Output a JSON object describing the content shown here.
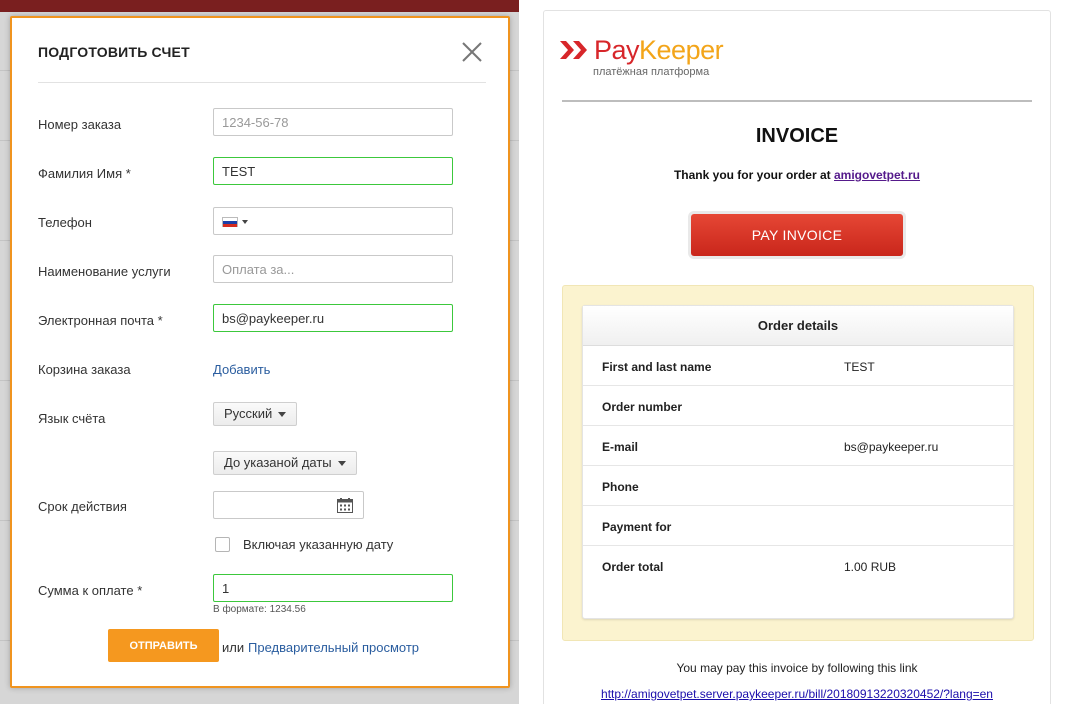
{
  "modal": {
    "title": "ПОДГОТОВИТЬ СЧЕТ",
    "fields": {
      "order_number": {
        "label": "Номер заказа",
        "value": "",
        "placeholder": "1234-56-78"
      },
      "full_name": {
        "label": "Фамилия Имя *",
        "value": "TEST",
        "placeholder": ""
      },
      "phone": {
        "label": "Телефон",
        "value": "",
        "flag": "ru-flag"
      },
      "service_name": {
        "label": "Наименование услуги",
        "value": "",
        "placeholder": "Оплата за..."
      },
      "email": {
        "label": "Электронная почта *",
        "value": "bs@paykeeper.ru",
        "placeholder": ""
      },
      "cart": {
        "label": "Корзина заказа",
        "link": "Добавить"
      },
      "language": {
        "label": "Язык счёта",
        "selected": "Русский"
      },
      "validity": {
        "label": "Срок действия",
        "mode": "До указаной даты",
        "date_value": "",
        "include_date_label": "Включая указанную дату",
        "include_date_checked": false
      },
      "amount": {
        "label": "Сумма к оплате *",
        "value": "1",
        "hint": "В формате: 1234.56"
      }
    },
    "submit_label": "ОТПРАВИТЬ",
    "or_text": "или",
    "preview_link": "Предварительный просмотр"
  },
  "invoice": {
    "logo": {
      "pay": "Pay",
      "keeper": "Keeper",
      "subtitle": "платёжная платформа"
    },
    "title": "INVOICE",
    "thanks_prefix": "Thank you for your order at",
    "shop_link": "amigovetpet.ru",
    "pay_button": "PAY INVOICE",
    "details_header": "Order details",
    "rows": [
      {
        "key": "First and last name",
        "value": "TEST"
      },
      {
        "key": "Order number",
        "value": ""
      },
      {
        "key": "E-mail",
        "value": "bs@paykeeper.ru"
      },
      {
        "key": "Phone",
        "value": ""
      },
      {
        "key": "Payment for",
        "value": ""
      },
      {
        "key": "Order total",
        "value": "1.00 RUB"
      }
    ],
    "pay_note": "You may pay this invoice by following this link",
    "pay_url": "http://amigovetpet.server.paykeeper.ru/bill/20180913220320452/?lang=en"
  },
  "colors": {
    "accent_orange": "#f5981f",
    "valid_green": "#3cc83c",
    "pay_red": "#d7262a",
    "logo_yellow": "#f3a51a"
  }
}
